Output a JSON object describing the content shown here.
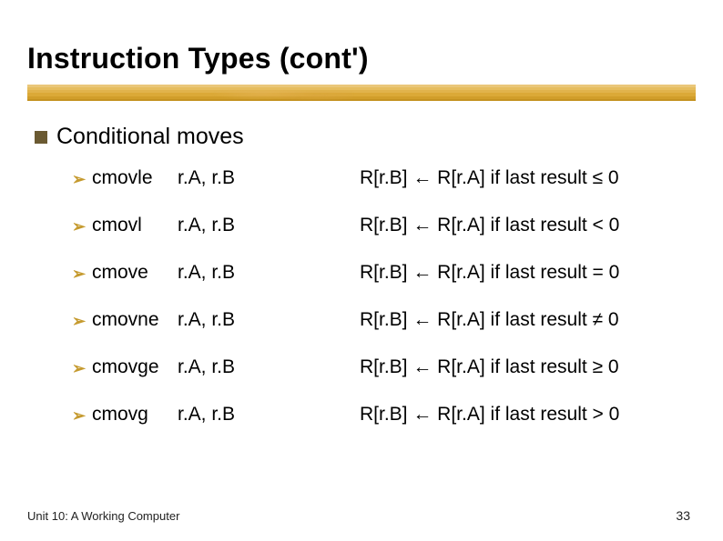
{
  "title": "Instruction Types (cont')",
  "subtitle": "Conditional moves",
  "items": [
    {
      "mnemonic": "cmovle",
      "args": "r.A, r.B",
      "desc": "R[r.B] ← R[r.A] if last result ≤ 0"
    },
    {
      "mnemonic": "cmovl",
      "args": "r.A, r.B",
      "desc": "R[r.B] ← R[r.A] if last result < 0"
    },
    {
      "mnemonic": "cmove",
      "args": "r.A, r.B",
      "desc": "R[r.B] ← R[r.A] if last result = 0"
    },
    {
      "mnemonic": "cmovne",
      "args": "r.A, r.B",
      "desc": "R[r.B] ← R[r.A] if last result ≠ 0"
    },
    {
      "mnemonic": "cmovge",
      "args": "r.A, r.B",
      "desc": "R[r.B] ← R[r.A] if last result ≥ 0"
    },
    {
      "mnemonic": "cmovg",
      "args": "r.A, r.B",
      "desc": "R[r.B] ← R[r.A] if last result > 0"
    }
  ],
  "footer": {
    "left": "Unit 10: A Working Computer",
    "page": "33"
  },
  "icons": {
    "square_bullet": "■",
    "arrow_bullet": "➢"
  }
}
